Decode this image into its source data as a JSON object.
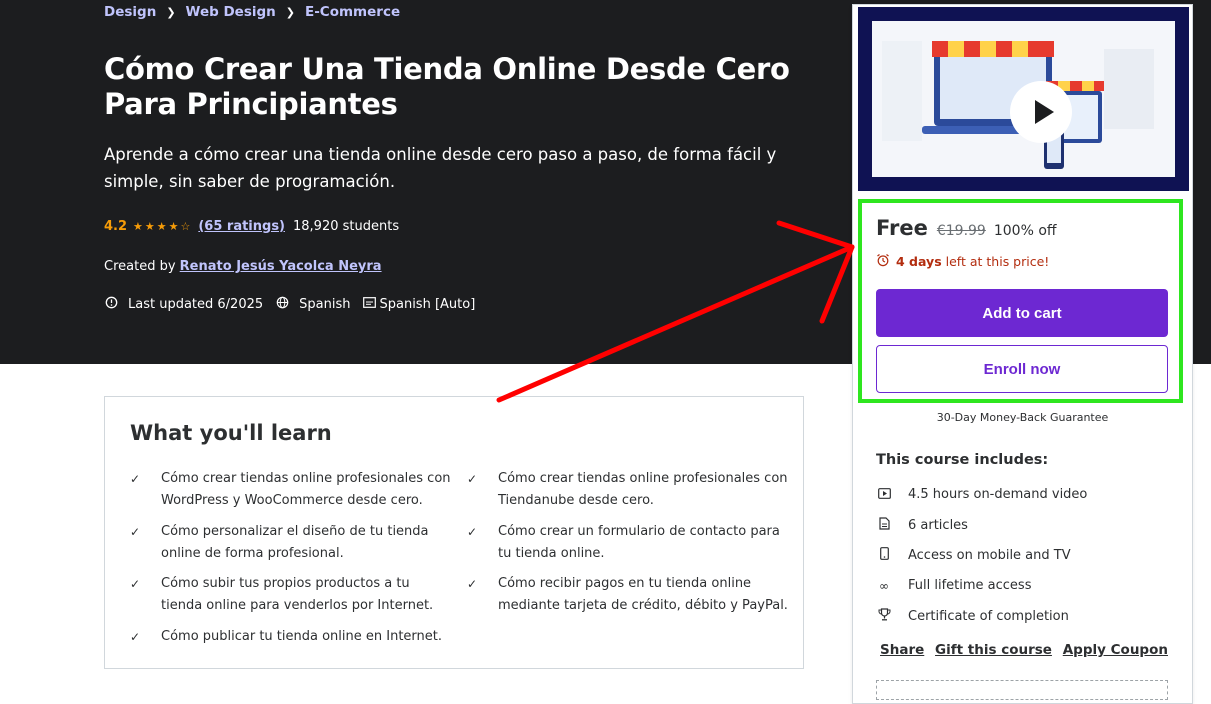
{
  "breadcrumb": [
    "Design",
    "Web Design",
    "E-Commerce"
  ],
  "hero": {
    "title": "Cómo Crear Una Tienda Online Desde Cero Para Principiantes",
    "subtitle": "Aprende a cómo crear una tienda online desde cero paso a paso, de forma fácil y simple, sin saber de programación.",
    "rating": "4.2",
    "stars": "★★★★☆",
    "ratings_link": "(65 ratings)",
    "students": "18,920 students",
    "created_prefix": "Created by",
    "instructor": "Renato Jesús Yacolca Neyra",
    "last_updated": "Last updated 6/2025",
    "language": "Spanish",
    "captions": "Spanish [Auto]"
  },
  "learn": {
    "title": "What you'll learn",
    "items": [
      "Cómo crear tiendas online profesionales con WordPress y WooCommerce desde cero.",
      "Cómo crear tiendas online profesionales con Tiendanube desde cero.",
      "Cómo personalizar el diseño de tu tienda online de forma profesional.",
      "Cómo crear un formulario de contacto para tu tienda online.",
      "Cómo subir tus propios productos a tu tienda online para venderlos por Internet.",
      "Cómo recibir pagos en tu tienda online mediante tarjeta de crédito, débito y PayPal.",
      "Cómo publicar tu tienda online en Internet."
    ]
  },
  "card": {
    "price_now": "Free",
    "price_old": "€19.99",
    "discount": "100% off",
    "timer_days": "4 days",
    "timer_text": "left at this price!",
    "add_to_cart": "Add to cart",
    "enroll": "Enroll now",
    "guarantee": "30-Day Money-Back Guarantee",
    "includes_title": "This course includes:",
    "includes": [
      "4.5 hours on-demand video",
      "6 articles",
      "Access on mobile and TV",
      "Full lifetime access",
      "Certificate of completion"
    ],
    "links": [
      "Share",
      "Gift this course",
      "Apply Coupon"
    ]
  },
  "colors": {
    "hero_bg": "#1c1d1f",
    "accent": "#6d28d2",
    "link": "#c0c4fc",
    "star": "#f69c08",
    "timer": "#b32d0f",
    "annotation_box": "#2ee61f",
    "annotation_arrow": "#ff0000"
  },
  "icons": {
    "breadcrumb_sep": "chevron-right-icon",
    "last_updated": "alert-clock-icon",
    "language": "globe-icon",
    "captions": "closed-captions-icon",
    "learn_check": "check-icon",
    "timer": "alarm-clock-icon",
    "includes": [
      "video-icon",
      "file-icon",
      "mobile-icon",
      "infinity-icon",
      "trophy-icon"
    ]
  }
}
